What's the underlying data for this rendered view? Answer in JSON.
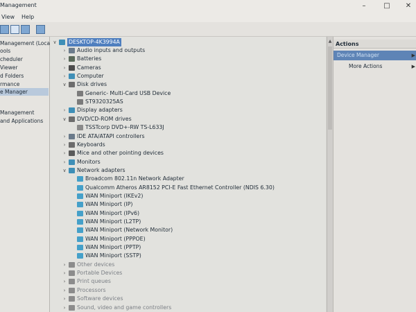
{
  "window": {
    "title": "Management",
    "minimize_icon": "minimize-icon",
    "maximize_icon": "maximize-icon",
    "close_icon": "close-icon"
  },
  "menu": {
    "view": "View",
    "help": "Help"
  },
  "left_nav": {
    "items": [
      {
        "label": "Management (Local"
      },
      {
        "label": "ools"
      },
      {
        "label": "cheduler"
      },
      {
        "label": "Viewer"
      },
      {
        "label": "d Folders"
      },
      {
        "label": "rmance"
      },
      {
        "label": "e Manager"
      },
      {
        "label": "Management"
      },
      {
        "label": "and Applications"
      }
    ]
  },
  "tree": {
    "root": "DESKTOP-4K3994A",
    "categories": [
      {
        "label": "Audio inputs and outputs",
        "icon": "speaker-icon",
        "state": "collapsed"
      },
      {
        "label": "Batteries",
        "icon": "battery-icon",
        "state": "collapsed"
      },
      {
        "label": "Cameras",
        "icon": "camera-icon",
        "state": "collapsed"
      },
      {
        "label": "Computer",
        "icon": "computer-icon",
        "state": "collapsed"
      },
      {
        "label": "Disk drives",
        "icon": "disk-drive-icon",
        "state": "expanded"
      },
      {
        "label": "Generic- Multi-Card USB Device",
        "icon": "disk-icon",
        "state": "child"
      },
      {
        "label": "ST9320325AS",
        "icon": "disk-icon",
        "state": "child"
      },
      {
        "label": "Display adapters",
        "icon": "display-adapter-icon",
        "state": "collapsed"
      },
      {
        "label": "DVD/CD-ROM drives",
        "icon": "dvd-drive-icon",
        "state": "expanded"
      },
      {
        "label": "TSSTcorp DVD+-RW TS-L633J",
        "icon": "dvd-icon",
        "state": "child"
      },
      {
        "label": "IDE ATA/ATAPI controllers",
        "icon": "ide-controller-icon",
        "state": "collapsed"
      },
      {
        "label": "Keyboards",
        "icon": "keyboard-icon",
        "state": "collapsed"
      },
      {
        "label": "Mice and other pointing devices",
        "icon": "mouse-icon",
        "state": "collapsed"
      },
      {
        "label": "Monitors",
        "icon": "monitor-icon",
        "state": "collapsed"
      },
      {
        "label": "Network adapters",
        "icon": "network-adapter-icon",
        "state": "expanded"
      },
      {
        "label": "Broadcom 802.11n Network Adapter",
        "icon": "network-icon",
        "state": "child"
      },
      {
        "label": "Qualcomm Atheros AR8152 PCI-E Fast Ethernet Controller (NDIS 6.30)",
        "icon": "network-icon",
        "state": "child"
      },
      {
        "label": "WAN Miniport (IKEv2)",
        "icon": "network-icon",
        "state": "child"
      },
      {
        "label": "WAN Miniport (IP)",
        "icon": "network-icon",
        "state": "child"
      },
      {
        "label": "WAN Miniport (IPv6)",
        "icon": "network-icon",
        "state": "child"
      },
      {
        "label": "WAN Miniport (L2TP)",
        "icon": "network-icon",
        "state": "child"
      },
      {
        "label": "WAN Miniport (Network Monitor)",
        "icon": "network-icon",
        "state": "child"
      },
      {
        "label": "WAN Miniport (PPPOE)",
        "icon": "network-icon",
        "state": "child"
      },
      {
        "label": "WAN Miniport (PPTP)",
        "icon": "network-icon",
        "state": "child"
      },
      {
        "label": "WAN Miniport (SSTP)",
        "icon": "network-icon",
        "state": "child"
      },
      {
        "label": "Other devices",
        "icon": "other-devices-icon",
        "state": "collapsed-gray"
      },
      {
        "label": "Portable Devices",
        "icon": "portable-device-icon",
        "state": "collapsed-gray"
      },
      {
        "label": "Print queues",
        "icon": "printer-icon",
        "state": "collapsed-gray"
      },
      {
        "label": "Processors",
        "icon": "processor-icon",
        "state": "collapsed-gray"
      },
      {
        "label": "Software devices",
        "icon": "software-device-icon",
        "state": "collapsed-gray"
      },
      {
        "label": "Sound, video and game controllers",
        "icon": "sound-icon",
        "state": "collapsed-gray"
      }
    ]
  },
  "actions": {
    "header": "Actions",
    "primary": "Device Manager",
    "more": "More Actions"
  },
  "colors": {
    "selection": "#4f7fbf",
    "action_highlight": "#5e84b6",
    "icon_blue": "#3f8fb7"
  }
}
